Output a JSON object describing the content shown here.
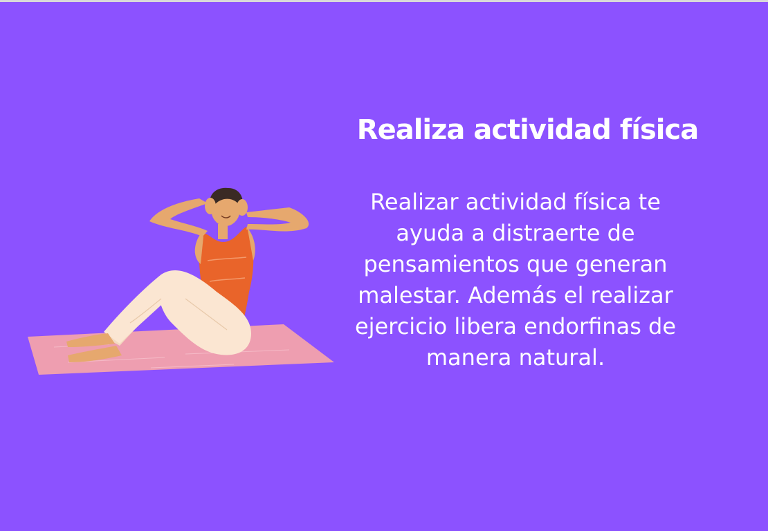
{
  "slide": {
    "title": "Realiza actividad física",
    "body_lines": [
      "Realizar actividad física  te",
      "ayuda a distraerte de",
      "pensamientos que generan",
      "malestar. Además el realizar",
      "ejercicio libera endorfinas de",
      "manera natural."
    ]
  },
  "colors": {
    "background": "#8c52ff",
    "text": "#ffffff",
    "mat": "#ee9eb0",
    "top": "#e9642a",
    "pants": "#fbe6d2",
    "skin": "#e6a86e",
    "hair": "#3a2a24"
  },
  "illustration": {
    "icon": "woman-doing-situps-on-mat-illustration"
  }
}
